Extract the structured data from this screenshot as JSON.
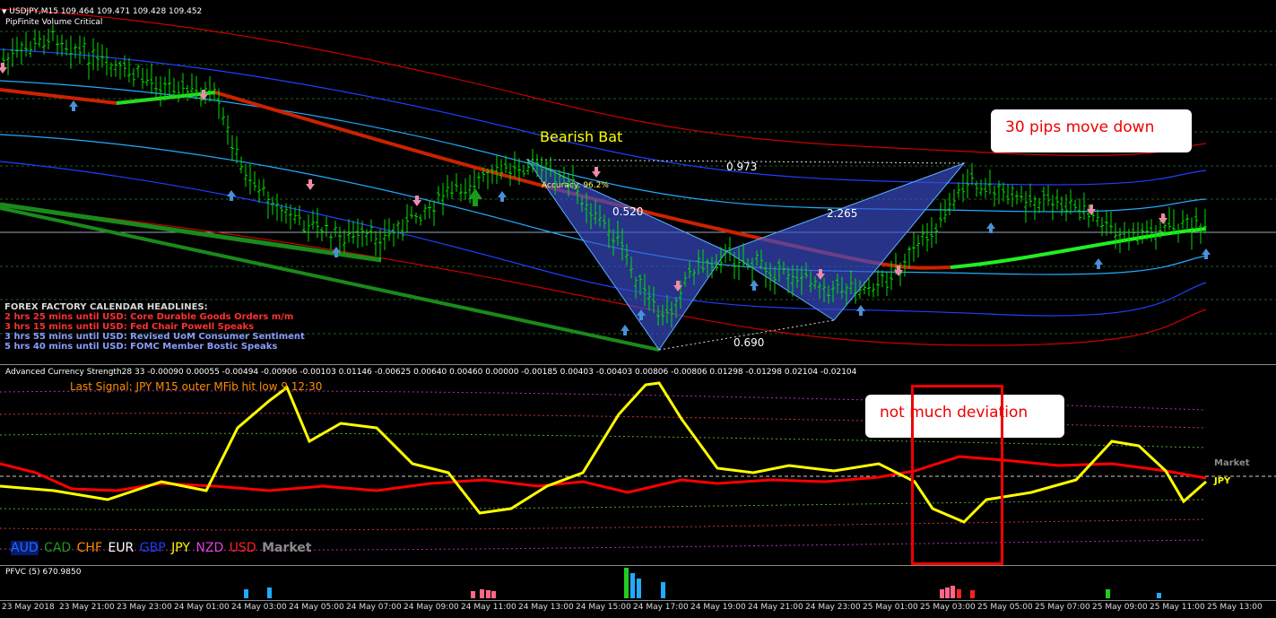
{
  "chart_header": {
    "symbol_line": "USDJPY,M15  109.464 109.471 109.428 109.452",
    "indicator_name": "PipFinite Volume Critical"
  },
  "pattern": {
    "name": "Bearish Bat",
    "accuracy": "Accuracy: 96.2%",
    "ratio_1": "0.973",
    "ratio_2": "0.520",
    "ratio_3": "2.265",
    "ratio_4": "0.690"
  },
  "callouts": {
    "pips": "30 pips move down",
    "deviation": "not much deviation"
  },
  "news": {
    "title": "FOREX FACTORY CALENDAR HEADLINES:",
    "items": [
      {
        "text": "2 hrs 25 mins until USD: Core Durable Goods Orders m/m",
        "color": "#ff3030"
      },
      {
        "text": "3 hrs 15 mins until USD: Fed Chair Powell Speaks",
        "color": "#ff3030"
      },
      {
        "text": "3 hrs 55 mins until USD: Revised UoM Consumer Sentiment",
        "color": "#8a9cff"
      },
      {
        "text": "5 hrs 40 mins until USD: FOMC Member Bostic Speaks",
        "color": "#8a9cff"
      }
    ]
  },
  "oscillator": {
    "header": "Advanced Currency Strength28 33 -0.00090 0.00055 -0.00494 -0.00906 -0.00103 0.01146 -0.00625 0.00640 0.00460 0.00000 -0.00185 0.00403 -0.00403 0.00806 -0.00806 0.01298 -0.01298 0.02104 -0.02104",
    "last_signal": "Last Signal:  JPY M15 outer MFib hit low 9 12:30",
    "market_right": "Market",
    "jpy_right": "JPY",
    "legend": [
      {
        "label": "AUD",
        "color": "#1e6cff"
      },
      {
        "label": "CAD",
        "color": "#1a9a1a"
      },
      {
        "label": "CHF",
        "color": "#ff8a00"
      },
      {
        "label": "EUR",
        "color": "#ffffff"
      },
      {
        "label": "GBP",
        "color": "#1e3cff"
      },
      {
        "label": "JPY",
        "color": "#ffff00"
      },
      {
        "label": "NZD",
        "color": "#e040e0"
      },
      {
        "label": "USD",
        "color": "#ff2020"
      },
      {
        "label": "Market",
        "color": "#8a8a8a"
      }
    ]
  },
  "volume": {
    "header": "PFVC (5) 670.9850"
  },
  "time_axis": [
    "23 May 2018",
    "23 May 21:00",
    "23 May 23:00",
    "24 May 01:00",
    "24 May 03:00",
    "24 May 05:00",
    "24 May 07:00",
    "24 May 09:00",
    "24 May 11:00",
    "24 May 13:00",
    "24 May 15:00",
    "24 May 17:00",
    "24 May 19:00",
    "24 May 21:00",
    "24 May 23:00",
    "25 May 01:00",
    "25 May 03:00",
    "25 May 05:00",
    "25 May 07:00",
    "25 May 09:00",
    "25 May 11:00",
    "25 May 13:00"
  ],
  "colors": {
    "background": "#000000",
    "bull_candle": "#00e000",
    "band_red": "#cc0000",
    "band_blue": "#1e40ff",
    "band_cyan": "#22aaff",
    "jpy_line": "#ffff00",
    "usd_line": "#ff0000",
    "harmonic_fill": "#3a4fd0"
  }
}
